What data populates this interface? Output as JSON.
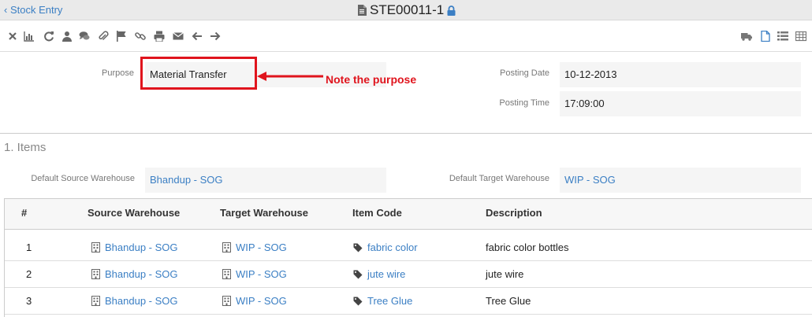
{
  "header": {
    "back_label": "Stock Entry",
    "doc_id": "STE00011-1"
  },
  "toolbar": {
    "left_icons": [
      "close-icon",
      "chart-icon",
      "refresh-icon",
      "user-icon",
      "comments-icon",
      "paperclip-icon",
      "flag-icon",
      "link-icon",
      "print-icon",
      "envelope-icon",
      "arrow-left-icon",
      "arrow-right-icon"
    ],
    "right_icons": [
      "truck-icon",
      "file-icon",
      "list-icon",
      "table-icon"
    ]
  },
  "form": {
    "purpose_label": "Purpose",
    "purpose_value": "Material Transfer",
    "posting_date_label": "Posting Date",
    "posting_date_value": "10-12-2013",
    "posting_time_label": "Posting Time",
    "posting_time_value": "17:09:00"
  },
  "annotation": {
    "text": "Note the purpose",
    "color": "#e0141d"
  },
  "items_section": {
    "title": "1. Items",
    "default_source_label": "Default Source Warehouse",
    "default_source_value": "Bhandup - SOG",
    "default_target_label": "Default Target Warehouse",
    "default_target_value": "WIP - SOG"
  },
  "grid": {
    "headers": [
      "#",
      "Source Warehouse",
      "Target Warehouse",
      "Item Code",
      "Description"
    ],
    "rows": [
      {
        "idx": "1",
        "source": "Bhandup - SOG",
        "target": "WIP - SOG",
        "item": "fabric color",
        "desc": "fabric color bottles"
      },
      {
        "idx": "2",
        "source": "Bhandup - SOG",
        "target": "WIP - SOG",
        "item": "jute wire",
        "desc": "jute wire"
      },
      {
        "idx": "3",
        "source": "Bhandup - SOG",
        "target": "WIP - SOG",
        "item": "Tree Glue",
        "desc": "Tree Glue"
      }
    ]
  },
  "colors": {
    "link": "#3b7fc4",
    "accent": "#e0141d"
  }
}
